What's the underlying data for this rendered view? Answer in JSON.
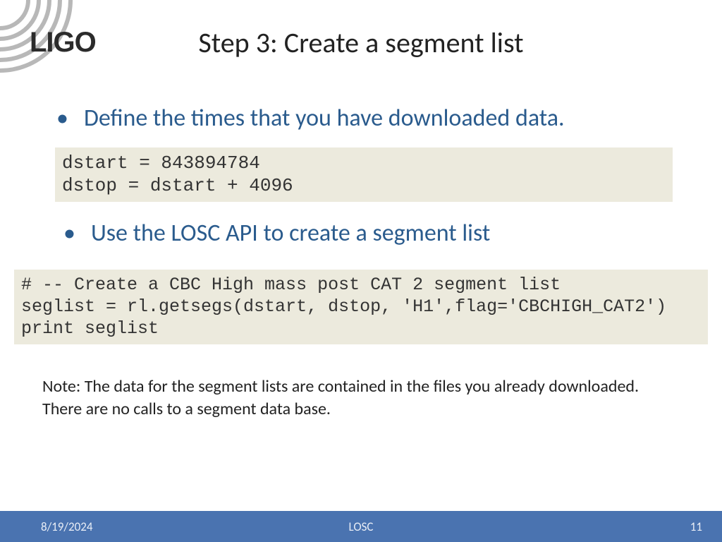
{
  "logo": {
    "text": "LIGO"
  },
  "title": "Step 3: Create a segment list",
  "bullets": {
    "b1": "Define the times that you have downloaded data.",
    "b2": "Use the LOSC API to create a segment list"
  },
  "code": {
    "block1": "dstart = 843894784\ndstop = dstart + 4096",
    "block2": "# -- Create a CBC High mass post CAT 2 segment list\nseglist = rl.getsegs(dstart, dstop, 'H1',flag='CBCHIGH_CAT2')\nprint seglist"
  },
  "note": "Note: The data for the segment lists are contained in the files you already downloaded.  There are no calls to a segment data base.",
  "footer": {
    "date": "8/19/2024",
    "center": "LOSC",
    "page": "11"
  }
}
